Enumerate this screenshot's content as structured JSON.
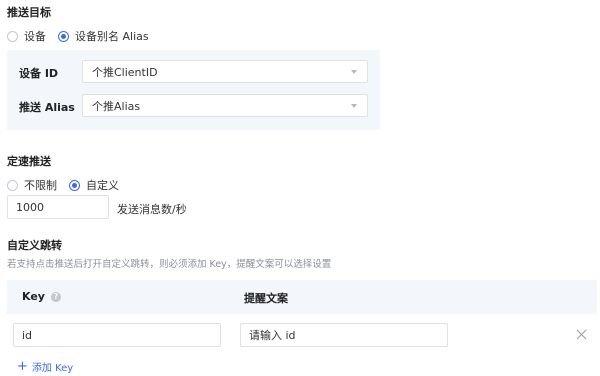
{
  "push_target": {
    "title": "推送目标",
    "options": [
      {
        "label": "设备",
        "checked": false
      },
      {
        "label": "设备别名 Alias",
        "checked": true
      }
    ],
    "device_id_label": "设备 ID",
    "device_id_value": "个推ClientID",
    "alias_label": "推送 Alias",
    "alias_value": "个推Alias"
  },
  "rate_push": {
    "title": "定速推送",
    "options": [
      {
        "label": "不限制",
        "checked": false
      },
      {
        "label": "自定义",
        "checked": true
      }
    ],
    "rate_value": "1000",
    "rate_unit": "发送消息数/秒"
  },
  "custom_jump": {
    "title": "自定义跳转",
    "hint": "若支持点击推送后打开自定义跳转，则必须添加 Key，提醒文案可以选择设置",
    "columns": {
      "key": "Key",
      "text": "提醒文案"
    },
    "rows": [
      {
        "key": "id",
        "text": "请输入 id"
      }
    ],
    "add_label": "添加 Key"
  }
}
